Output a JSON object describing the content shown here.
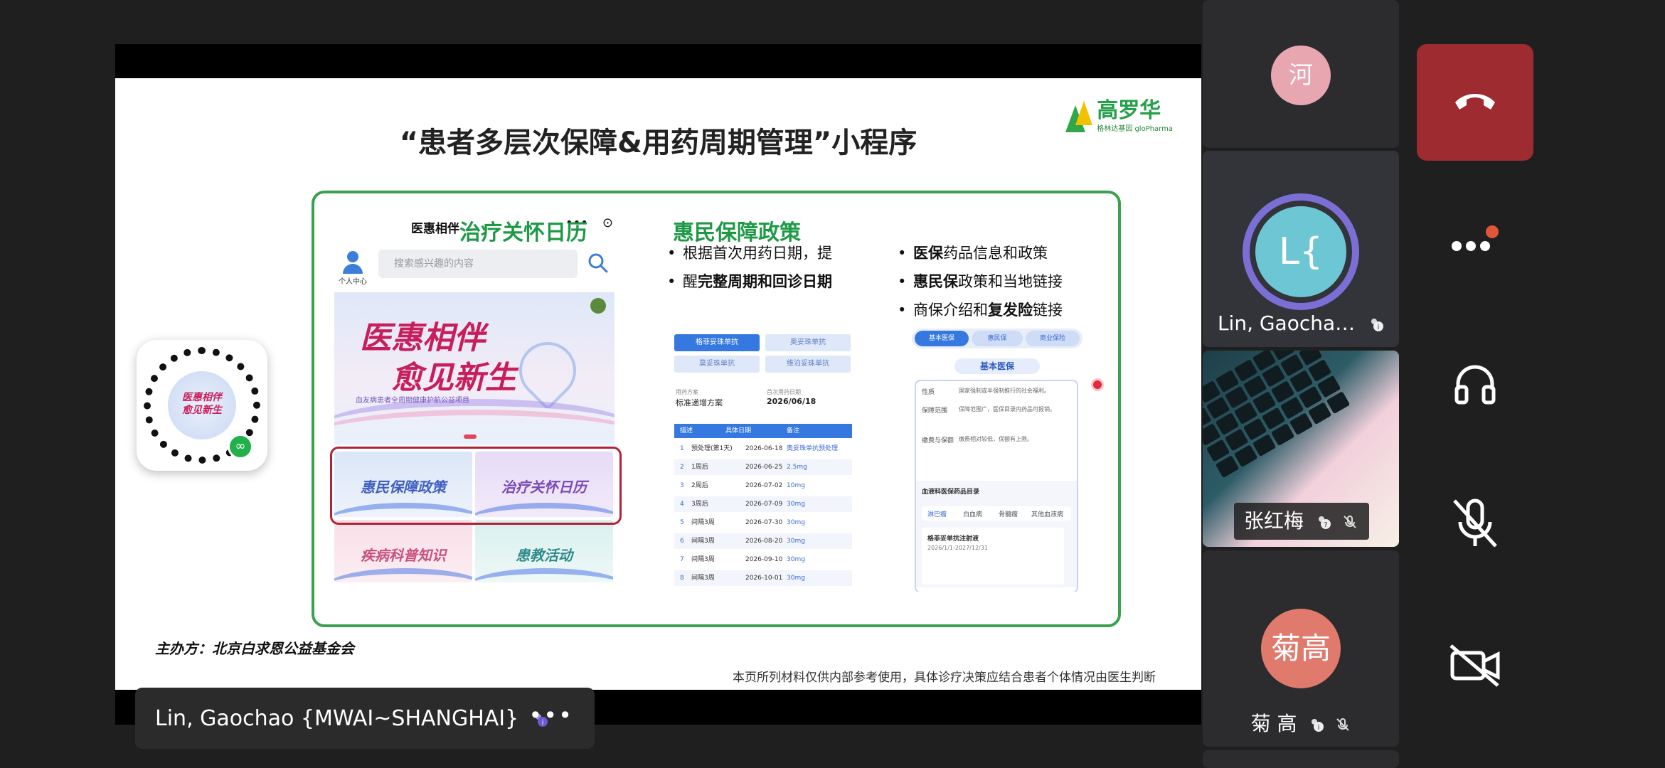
{
  "slide": {
    "title": "“患者多层次保障&用药周期管理”小程序",
    "logo_name": "高罗华",
    "logo_sub": "格林达基因 gloPharma",
    "organizer": "主办方：北京白求恩公益基金会",
    "disclaimer": "本页所列材料仅供内部参考使用，具体诊疗决策应结合患者个体情况由医生判断"
  },
  "phone": {
    "title": "医惠相伴",
    "menu_glyph": "•••",
    "record_glyph": "⊙",
    "user_label": "个人中心",
    "search_placeholder": "搜索感兴趣的内容",
    "banner_line1": "医惠相伴",
    "banner_line2": "愈见新生",
    "banner_sub": "血友病患者全周期健康护航公益项目",
    "tiles": [
      "惠民保障政策",
      "治疗关怀日历",
      "疾病科普知识",
      "患教活动"
    ]
  },
  "calendar_section": {
    "title": "治疗关怀日历",
    "bullet_1a": "根据首次用药日期，提",
    "bullet_1b_pre": "醒",
    "bullet_1b_bold": "完整周期和回诊日期",
    "buttons": [
      "格菲妥珠单抗",
      "奥妥珠单抗",
      "莫妥珠单抗",
      "维泊妥珠单抗"
    ],
    "plan_label": "用药方案",
    "plan_value": "标准递增方案",
    "date_label": "首次用药日期",
    "date_value": "2026/06/18",
    "table_headers": [
      "描述",
      "具体日期",
      "备注"
    ],
    "rows": [
      {
        "n": "1",
        "desc": "预处理(第1天)",
        "date": "2026-06-18",
        "note": "奥妥珠单抗预处理"
      },
      {
        "n": "2",
        "desc": "1周后",
        "date": "2026-06-25",
        "note": "2.5mg"
      },
      {
        "n": "3",
        "desc": "2周后",
        "date": "2026-07-02",
        "note": "10mg"
      },
      {
        "n": "4",
        "desc": "3周后",
        "date": "2026-07-09",
        "note": "30mg"
      },
      {
        "n": "5",
        "desc": "间隔3周",
        "date": "2026-07-30",
        "note": "30mg"
      },
      {
        "n": "6",
        "desc": "间隔3周",
        "date": "2026-08-20",
        "note": "30mg"
      },
      {
        "n": "7",
        "desc": "间隔3周",
        "date": "2026-09-10",
        "note": "30mg"
      },
      {
        "n": "8",
        "desc": "间隔3周",
        "date": "2026-10-01",
        "note": "30mg"
      }
    ]
  },
  "policy_section": {
    "title": "惠民保障政策",
    "b1_bold": "医保",
    "b1_rest": "药品信息和政策",
    "b2_bold": "惠民保",
    "b2_rest": "政策和当地链接",
    "b3_pre": "商保介绍和",
    "b3_bold": "复发险",
    "b3_rest": "链接",
    "chips": [
      "基本医保",
      "惠民保",
      "商业保险"
    ],
    "card_heading": "基本医保",
    "card_lines": [
      "性质",
      "国家强制或半强制推行的社会福利。",
      "保障范围",
      "保障范围广，医保目录内药品可报销。",
      "缴费与保额",
      "缴费相对较低，保额有上限。"
    ],
    "catalog_title": "血液科医保药品目录",
    "catalog_tabs": [
      "淋巴瘤",
      "白血病",
      "骨髓瘤",
      "其他血液病"
    ],
    "drug_name": "格菲妥单抗注射液",
    "drug_period": "2026/1/1-2027/12/31"
  },
  "namebar": {
    "name": "Lin, Gaochao {MWAI~SHANGHAI}",
    "more": "•••"
  },
  "participants": [
    {
      "avatar": "河",
      "avatar_color": "#e8a6b1"
    },
    {
      "avatar": "L{",
      "avatar_color": "#6cc6d4",
      "ring_color": "#7b6fd6",
      "name": "Lin, Gaocha…"
    },
    {
      "name": "张红梅"
    },
    {
      "avatar": "菊高",
      "avatar_color": "#e07a6c",
      "name": "菊 高"
    }
  ],
  "colors": {
    "accent_green": "#1e9a46",
    "end_call": "#9e2b2f",
    "blue": "#3579e0"
  }
}
